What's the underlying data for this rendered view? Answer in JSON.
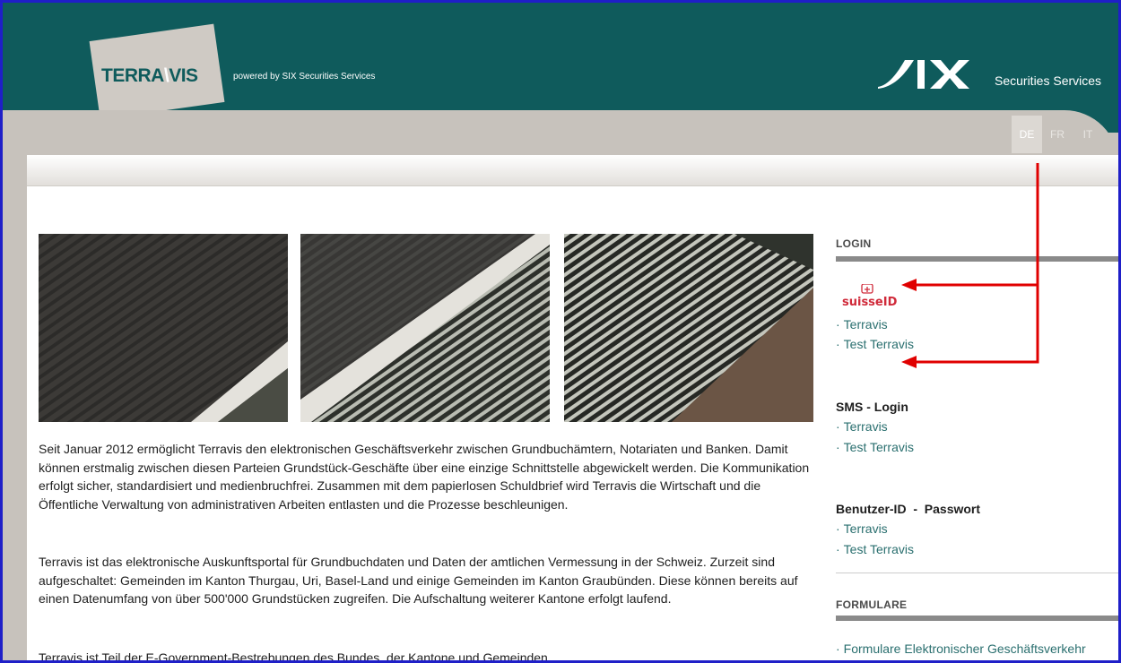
{
  "header": {
    "logo_left": "TERRA",
    "logo_right": "VIS",
    "powered_by": "powered by SIX Securities Services",
    "six_subtitle": "Securities Services",
    "languages": [
      "DE",
      "FR",
      "IT"
    ],
    "active_language": "DE"
  },
  "main": {
    "paragraphs": [
      "Seit Januar 2012 ermöglicht Terravis den elektronischen Geschäftsverkehr zwischen Grundbuchämtern, Notariaten und Banken. Damit können erstmalig zwischen diesen Parteien Grundstück-Geschäfte über eine einzige Schnittstelle abgewickelt werden. Die Kommunikation erfolgt sicher, standardisiert und medienbruchfrei. Zusammen mit dem papierlosen Schuldbrief wird Terravis die Wirtschaft und die Öffentliche Verwaltung von administrativen Arbeiten entlasten und die Prozesse beschleunigen.",
      "Terravis ist das elektronische Auskunftsportal für Grundbuchdaten und Daten der amtlichen Vermessung in der Schweiz. Zurzeit sind aufgeschaltet: Gemeinden im Kanton Thurgau, Uri, Basel-Land und einige Gemeinden im Kanton Graubünden. Diese können bereits auf einen Datenumfang von über 500'000 Grundstücken zugreifen. Die Aufschaltung weiterer Kantone erfolgt laufend.",
      "Terravis ist Teil der E-Government-Bestrebungen des Bundes, der Kantone und Gemeinden."
    ]
  },
  "sidebar": {
    "login_title": "LOGIN",
    "suisseid_label": "suisseID",
    "suisseid_links": [
      "Terravis",
      "Test Terravis"
    ],
    "sms_title": "SMS - Login",
    "sms_links": [
      "Terravis",
      "Test Terravis"
    ],
    "userpw_title": "Benutzer-ID  -  Passwort",
    "userpw_links": [
      "Terravis",
      "Test Terravis"
    ],
    "forms_title": "FORMULARE",
    "forms_links": [
      "Formulare Elektronischer Geschäftsverkehr"
    ],
    "bullet": "·"
  },
  "colors": {
    "header_bg": "#0f5b5c",
    "link": "#2a6f6f",
    "annotation_arrow": "#e00000",
    "frame_border": "#1f1fc8"
  }
}
